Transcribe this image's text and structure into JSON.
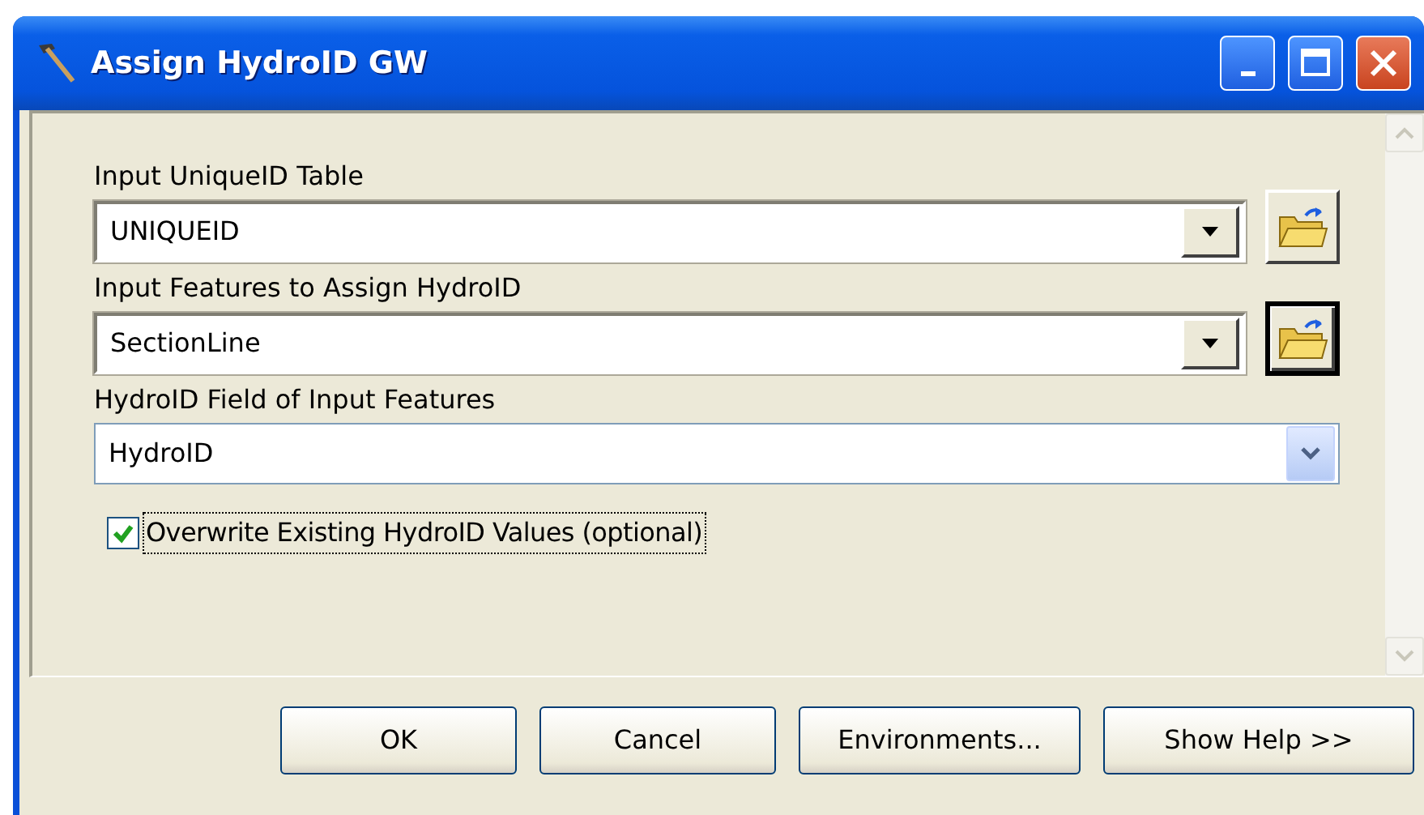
{
  "window": {
    "title": "Assign HydroID GW"
  },
  "parameters": [
    {
      "label": "Input UniqueID Table",
      "value": "UNIQUEID",
      "kind": "combo-browse",
      "browse_focused": false
    },
    {
      "label": "Input Features to Assign HydroID",
      "value": "SectionLine",
      "kind": "combo-browse",
      "browse_focused": true
    },
    {
      "label": "HydroID Field of Input Features",
      "value": "HydroID",
      "kind": "combo"
    }
  ],
  "option": {
    "label": "Overwrite Existing HydroID Values (optional)",
    "checked": true,
    "focused": true
  },
  "buttons": [
    "OK",
    "Cancel",
    "Environments...",
    "Show Help >>"
  ]
}
